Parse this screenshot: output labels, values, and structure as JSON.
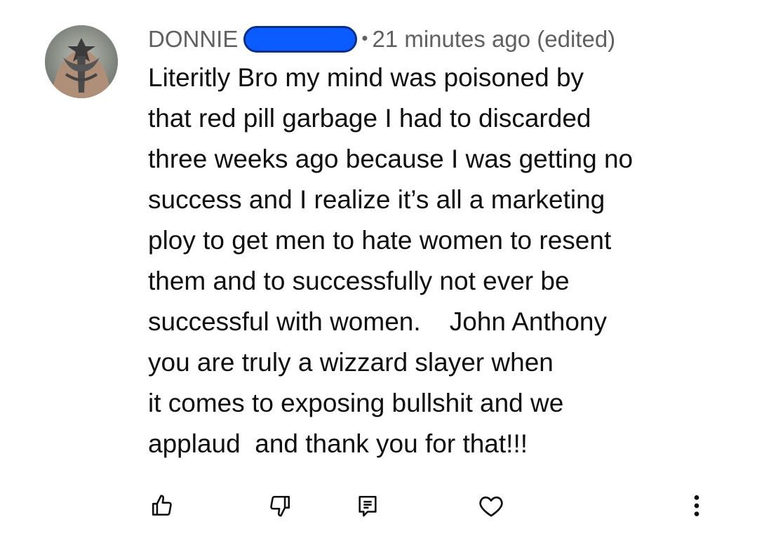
{
  "comment": {
    "author": "DONNIE",
    "separator": "•",
    "timestamp": "21 minutes ago (edited)",
    "text_lines": [
      "Literitly Bro my mind was poisoned by",
      "that red pill garbage I had to discarded",
      "three weeks ago because I was getting no",
      "success and I realize it’s all a marketing",
      "ploy to get men to hate women to resent",
      "them and to successfully not ever be",
      "successful with women.    John Anthony",
      "you are truly a wizzard slayer when",
      "it comes to exposing bullshit and we",
      "applaud  and thank you for that!!!"
    ]
  },
  "redaction_color": "#0a5cff",
  "actions": [
    {
      "icon": "thumbs-up-icon"
    },
    {
      "icon": "thumbs-down-icon"
    },
    {
      "icon": "reply-icon"
    },
    {
      "icon": "heart-icon"
    },
    {
      "icon": "more-options-icon"
    }
  ]
}
